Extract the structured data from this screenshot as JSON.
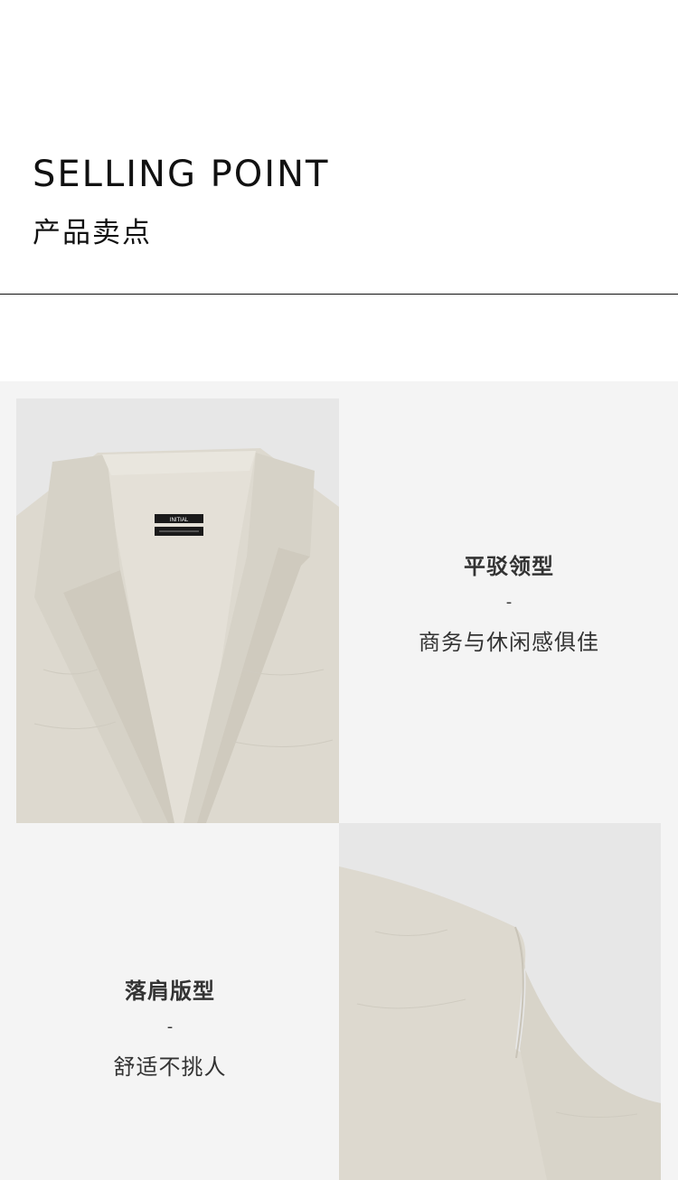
{
  "header": {
    "title_en": "SELLING POINT",
    "title_cn": "产品卖点"
  },
  "features": [
    {
      "title": "平驳领型",
      "dash": "-",
      "desc": "商务与休闲感俱佳"
    },
    {
      "title": "落肩版型",
      "dash": "-",
      "desc": "舒适不挑人"
    }
  ],
  "images": {
    "collar_label_1": "INITIAL",
    "fabric_color": "#ddd9cf",
    "background_color": "#e6e6e6"
  }
}
